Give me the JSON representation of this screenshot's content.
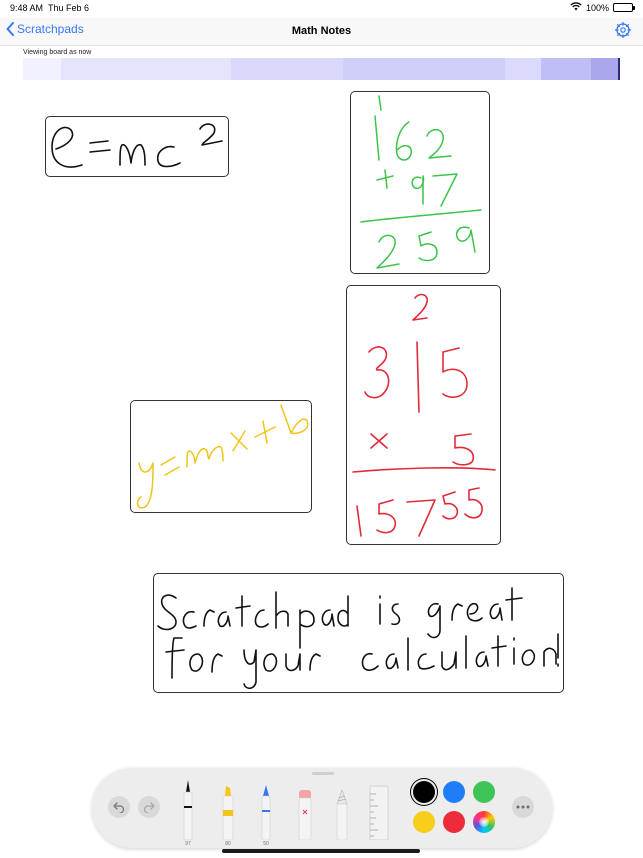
{
  "status_bar": {
    "time": "9:48 AM",
    "date": "Thu Feb 6",
    "battery": "100%"
  },
  "nav": {
    "back_label": "Scratchpads",
    "title": "Math Notes"
  },
  "timeline": {
    "caption": "Viewing board as now",
    "colors": [
      "#f1f1ff",
      "#e4e4fd",
      "#d9d8fb",
      "#cfcff9",
      "#dbdafc",
      "#bfbef5",
      "#a9a8ee"
    ]
  },
  "scratchpads": [
    {
      "name": "emc2",
      "color": "#111111"
    },
    {
      "name": "addition",
      "color": "#3cc44a"
    },
    {
      "name": "multiplication",
      "color": "#e02b3b"
    },
    {
      "name": "line-equation",
      "color": "#f2c31b"
    },
    {
      "name": "note",
      "color": "#111111"
    }
  ],
  "toolbar": {
    "tools": [
      {
        "name": "pen",
        "value": "97"
      },
      {
        "name": "marker",
        "value": "80"
      },
      {
        "name": "pencil",
        "value": "50"
      },
      {
        "name": "eraser",
        "value": ""
      },
      {
        "name": "lasso",
        "value": ""
      },
      {
        "name": "ruler",
        "value": ""
      }
    ],
    "colors": [
      "#000000",
      "#1f7ef5",
      "#3ec457",
      "#f7ce1b",
      "#ee2b3b"
    ],
    "selected_color": "#000000"
  }
}
